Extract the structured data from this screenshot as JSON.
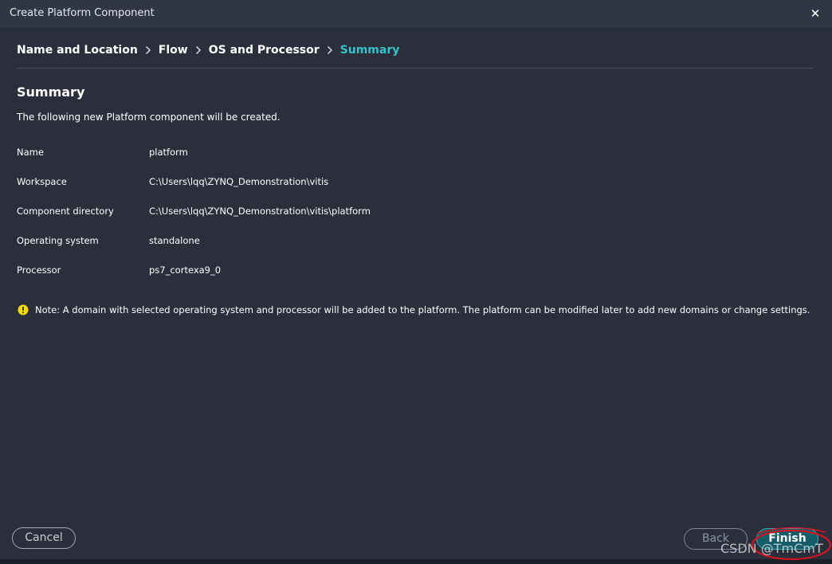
{
  "window": {
    "title": "Create Platform Component",
    "close_glyph": "✕"
  },
  "breadcrumb": {
    "items": [
      {
        "label": "Name and Location"
      },
      {
        "label": "Flow"
      },
      {
        "label": "OS and Processor"
      },
      {
        "label": "Summary",
        "active": true
      }
    ],
    "separator_icon": "chevron-right-icon"
  },
  "main": {
    "heading": "Summary",
    "description": "The following new Platform component will be created.",
    "rows": [
      {
        "key": "Name",
        "value": "platform"
      },
      {
        "key": "Workspace",
        "value": "C:\\Users\\lqq\\ZYNQ_Demonstration\\vitis"
      },
      {
        "key": "Component directory",
        "value": "C:\\Users\\lqq\\ZYNQ_Demonstration\\vitis\\platform"
      },
      {
        "key": "Operating system",
        "value": "standalone"
      },
      {
        "key": "Processor",
        "value": "ps7_cortexa9_0"
      }
    ],
    "note": {
      "icon": "warning-icon",
      "text": "Note: A domain with selected operating system and processor will be added to the platform. The platform can be modified later to add new domains or change settings."
    }
  },
  "footer": {
    "cancel_label": "Cancel",
    "back_label": "Back",
    "finish_label": "Finish"
  },
  "watermark": "CSDN @TmCmT",
  "colors": {
    "background": "#2a2f3b",
    "titlebar": "#303643",
    "accent": "#36c2c9",
    "finish_button": "#155d69",
    "warning": "#f5d90a",
    "annotation": "#d9141e"
  }
}
